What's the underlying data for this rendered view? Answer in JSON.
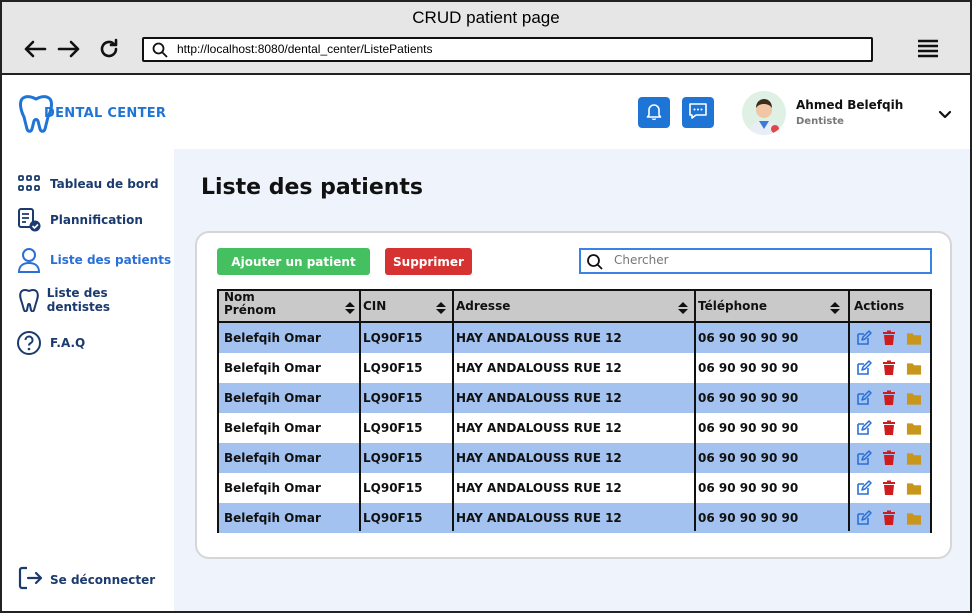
{
  "window": {
    "title": "CRUD patient page"
  },
  "browser": {
    "url": "http://localhost:8080/dental_center/ListePatients"
  },
  "brand": {
    "name": "DENTAL CENTER",
    "color": "#1f75d6"
  },
  "sidebar": {
    "items": [
      {
        "label": "Tableau de bord",
        "icon": "dashboard-grid-icon"
      },
      {
        "label": "Plannification",
        "icon": "planning-document-icon"
      },
      {
        "label": "Liste des patients",
        "icon": "user-icon",
        "active": true
      },
      {
        "label": "Liste des dentistes",
        "icon": "tooth-icon"
      },
      {
        "label": "F.A.Q",
        "icon": "question-icon"
      }
    ],
    "logout_label": "Se déconnecter"
  },
  "header": {
    "user_name": "Ahmed Belefqih",
    "user_role": "Dentiste"
  },
  "main": {
    "page_title": "Liste des patients",
    "add_button": "Ajouter un patient",
    "delete_button": "Supprimer",
    "search_placeholder": "Chercher",
    "table": {
      "headers": {
        "name_line1": "Nom",
        "name_line2": "Prénom",
        "cin": "CIN",
        "address": "Adresse",
        "phone": "Téléphone",
        "actions": "Actions"
      },
      "rows": [
        {
          "name": "Belefqih Omar",
          "cin": "LQ90F15",
          "address": "HAY ANDALOUSS RUE 12",
          "phone": "06 90 90 90 90"
        },
        {
          "name": "Belefqih Omar",
          "cin": "LQ90F15",
          "address": "HAY ANDALOUSS RUE 12",
          "phone": "06 90 90 90 90"
        },
        {
          "name": "Belefqih Omar",
          "cin": "LQ90F15",
          "address": "HAY ANDALOUSS RUE 12",
          "phone": "06 90 90 90 90"
        },
        {
          "name": "Belefqih Omar",
          "cin": "LQ90F15",
          "address": "HAY ANDALOUSS RUE 12",
          "phone": "06 90 90 90 90"
        },
        {
          "name": "Belefqih Omar",
          "cin": "LQ90F15",
          "address": "HAY ANDALOUSS RUE 12",
          "phone": "06 90 90 90 90"
        },
        {
          "name": "Belefqih Omar",
          "cin": "LQ90F15",
          "address": "HAY ANDALOUSS RUE 12",
          "phone": "06 90 90 90 90"
        },
        {
          "name": "Belefqih Omar",
          "cin": "LQ90F15",
          "address": "HAY ANDALOUSS RUE 12",
          "phone": "06 90 90 90 90"
        }
      ]
    }
  },
  "colors": {
    "add": "#45c061",
    "delete": "#d63231",
    "row_highlight": "#a3c2f0",
    "edit_icon": "#2a6fd6",
    "trash_icon": "#d01c1c",
    "folder_icon": "#c8961a"
  }
}
